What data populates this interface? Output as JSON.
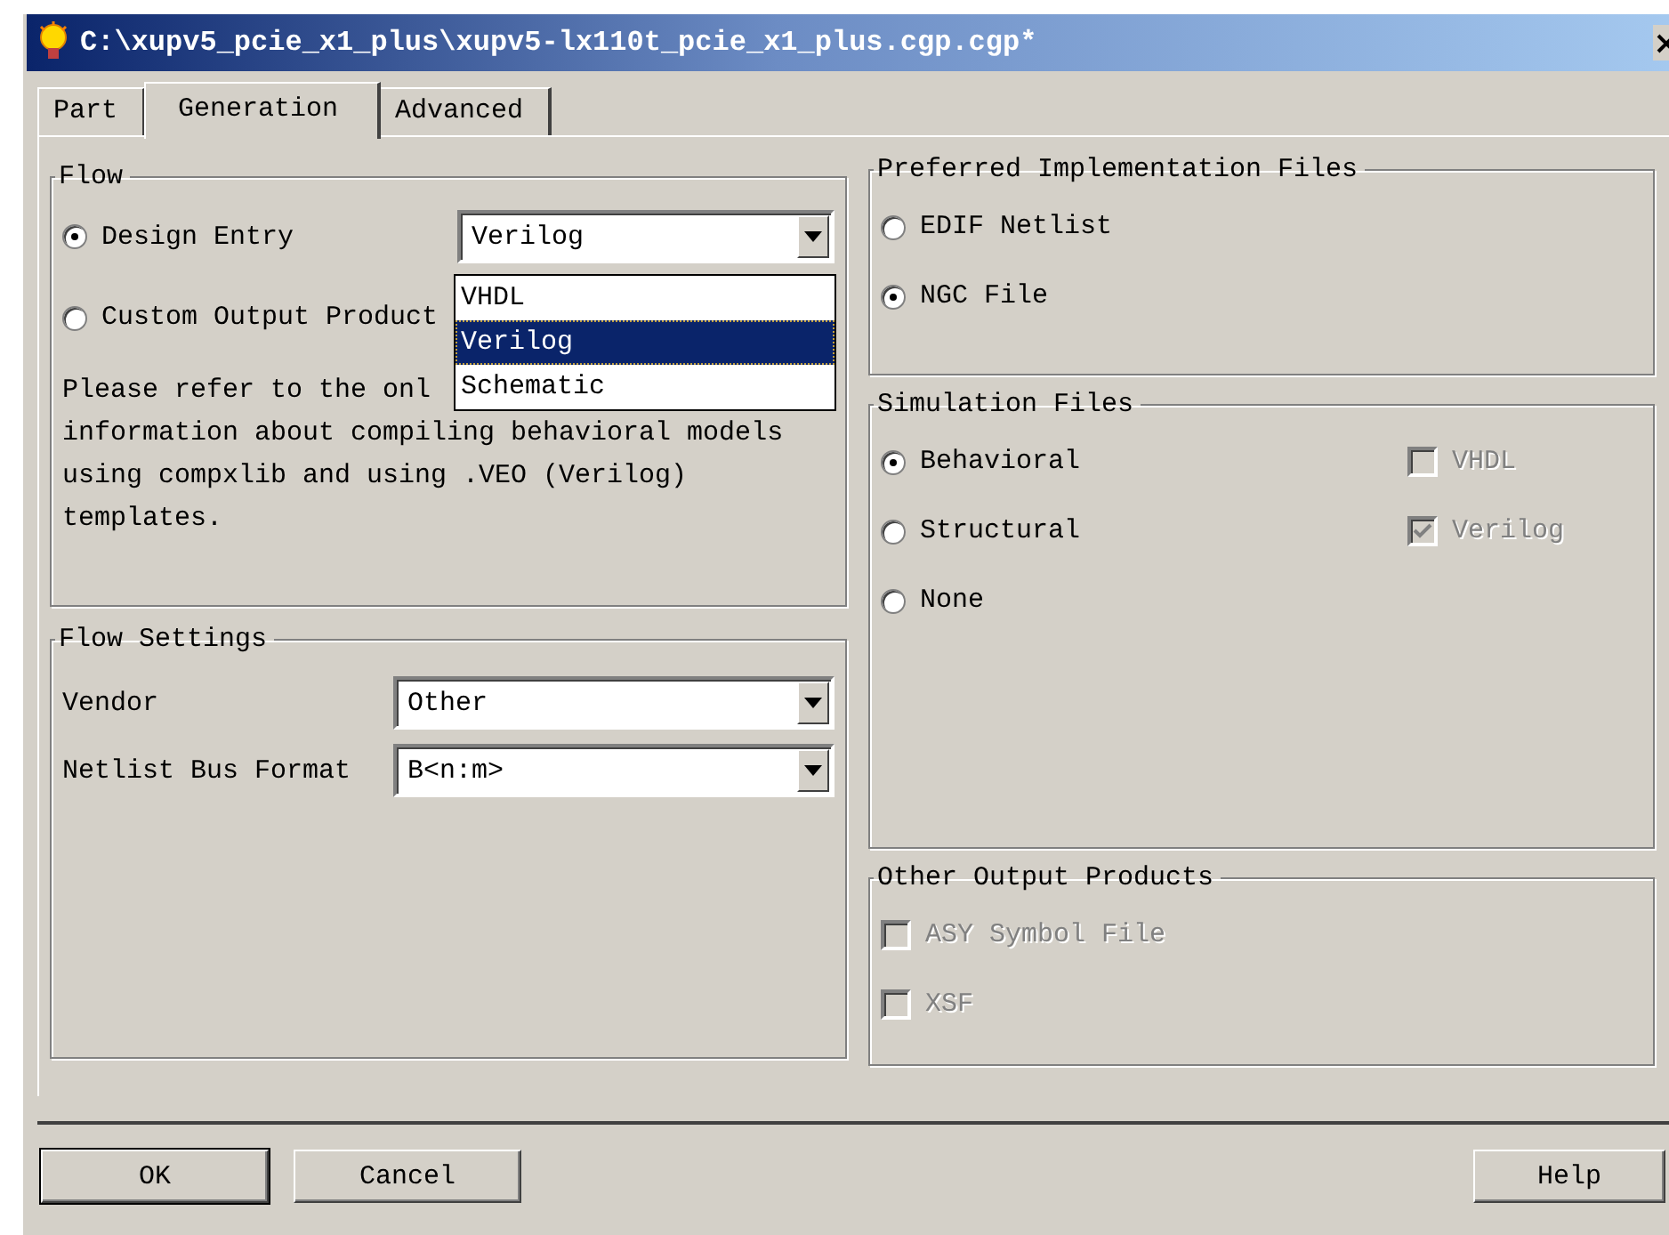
{
  "window": {
    "title": "C:\\xupv5_pcie_x1_plus\\xupv5-lx110t_pcie_x1_plus.cgp.cgp*"
  },
  "tabs": [
    {
      "label": "Part",
      "selected": false
    },
    {
      "label": "Generation",
      "selected": true
    },
    {
      "label": "Advanced",
      "selected": false
    }
  ],
  "flow": {
    "title": "Flow",
    "options": [
      {
        "label": "Design Entry",
        "selected": true
      },
      {
        "label": "Custom Output Product",
        "selected": false
      }
    ],
    "design_entry": {
      "value": "Verilog",
      "expanded": true,
      "options": [
        {
          "label": "VHDL",
          "selected": false
        },
        {
          "label": "Verilog",
          "selected": true
        },
        {
          "label": "Schematic",
          "selected": false
        }
      ]
    },
    "note_lines": [
      "Please refer to the onl",
      "information about compiling behavioral models",
      "using compxlib and using .VEO (Verilog)",
      "templates."
    ]
  },
  "flow_settings": {
    "title": "Flow Settings",
    "fields": [
      {
        "label": "Vendor",
        "value": "Other"
      },
      {
        "label": "Netlist Bus Format",
        "value": "B<n:m>"
      }
    ]
  },
  "preferred_implementation_files": {
    "title": "Preferred Implementation Files",
    "options": [
      {
        "label": "EDIF Netlist",
        "selected": false
      },
      {
        "label": "NGC File",
        "selected": true
      }
    ]
  },
  "simulation_files": {
    "title": "Simulation Files",
    "options": [
      {
        "label": "Behavioral",
        "selected": true
      },
      {
        "label": "Structural",
        "selected": false
      },
      {
        "label": "None",
        "selected": false
      }
    ],
    "languages": [
      {
        "label": "VHDL",
        "checked": false,
        "disabled": true
      },
      {
        "label": "Verilog",
        "checked": true,
        "disabled": true
      }
    ]
  },
  "other_output_products": {
    "title": "Other Output Products",
    "items": [
      {
        "label": "ASY Symbol File",
        "checked": false,
        "disabled": true
      },
      {
        "label": "XSF",
        "checked": false,
        "disabled": true
      }
    ]
  },
  "buttons": {
    "left": [
      "OK",
      "Cancel"
    ],
    "right": [
      "Help"
    ]
  }
}
